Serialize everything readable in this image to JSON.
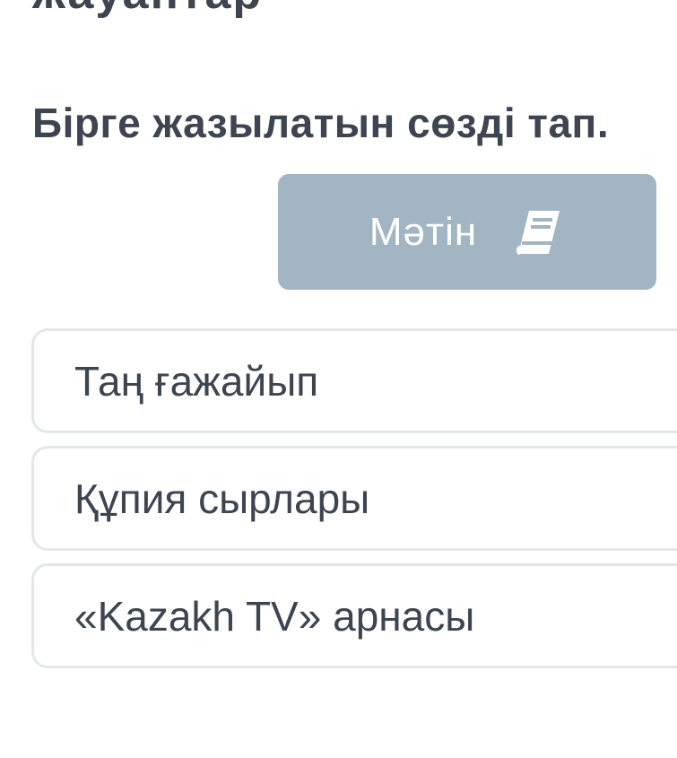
{
  "header": {
    "cut_title": "жауаптар"
  },
  "question": {
    "text": "Бірге жазылатын сөзді тап."
  },
  "text_button": {
    "label": "Мәтін",
    "icon": "book-icon",
    "color": "#a2b5c3"
  },
  "answers": [
    {
      "label": "Таң ғажайып"
    },
    {
      "label": "Құпия сырлары"
    },
    {
      "label": "«Kazakh TV» арнасы"
    }
  ],
  "colors": {
    "text": "#3d4551",
    "border": "#e3e7eb",
    "background": "#ffffff"
  }
}
